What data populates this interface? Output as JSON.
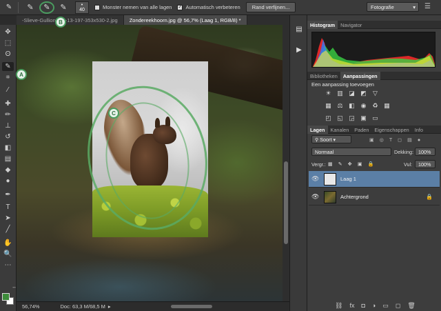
{
  "options_bar": {
    "brush_size": "40",
    "sample_all_layers_label": "Monster nemen van alle lagen",
    "sample_all_layers_checked": false,
    "auto_enhance_label": "Automatisch verbeteren",
    "auto_enhance_checked": true,
    "refine_edge_label": "Rand verfijnen...",
    "workspace": "Fotografie"
  },
  "tabs": [
    {
      "label": "-Slieve-Gullion...11-13-197-353x530-2.jpg",
      "active": false
    },
    {
      "label": "Zondereekhoorn.jpg @ 56,7% (Laag 1, RGB/8) *",
      "active": true
    }
  ],
  "markers": {
    "a": "A",
    "b": "B",
    "c": "C"
  },
  "status": {
    "zoom": "56,74%",
    "doc": "Doc: 63,3 M/68,5 M"
  },
  "panels": {
    "histogram_tabs": [
      "Histogram",
      "Navigator"
    ],
    "adjust_tabs": [
      "Bibliotheken",
      "Aanpassingen"
    ],
    "adjust_title": "Een aanpassing toevoegen",
    "layers_tabs": [
      "Lagen",
      "Kanalen",
      "Paden",
      "Eigenschappen",
      "Info"
    ],
    "filter_kind": "Soort",
    "blend_mode": "Normaal",
    "opacity_label": "Dekking:",
    "opacity_value": "100%",
    "lock_label": "Vergr.:",
    "fill_label": "Vul:",
    "fill_value": "100%",
    "layers": [
      {
        "name": "Laag 1",
        "selected": true
      },
      {
        "name": "Achtergrond",
        "selected": false
      }
    ]
  },
  "colors": {
    "foreground": "#3d8c3a",
    "background": "#ffffff",
    "accent": "#4a9d5f",
    "selected_layer": "#5b7fa6"
  }
}
